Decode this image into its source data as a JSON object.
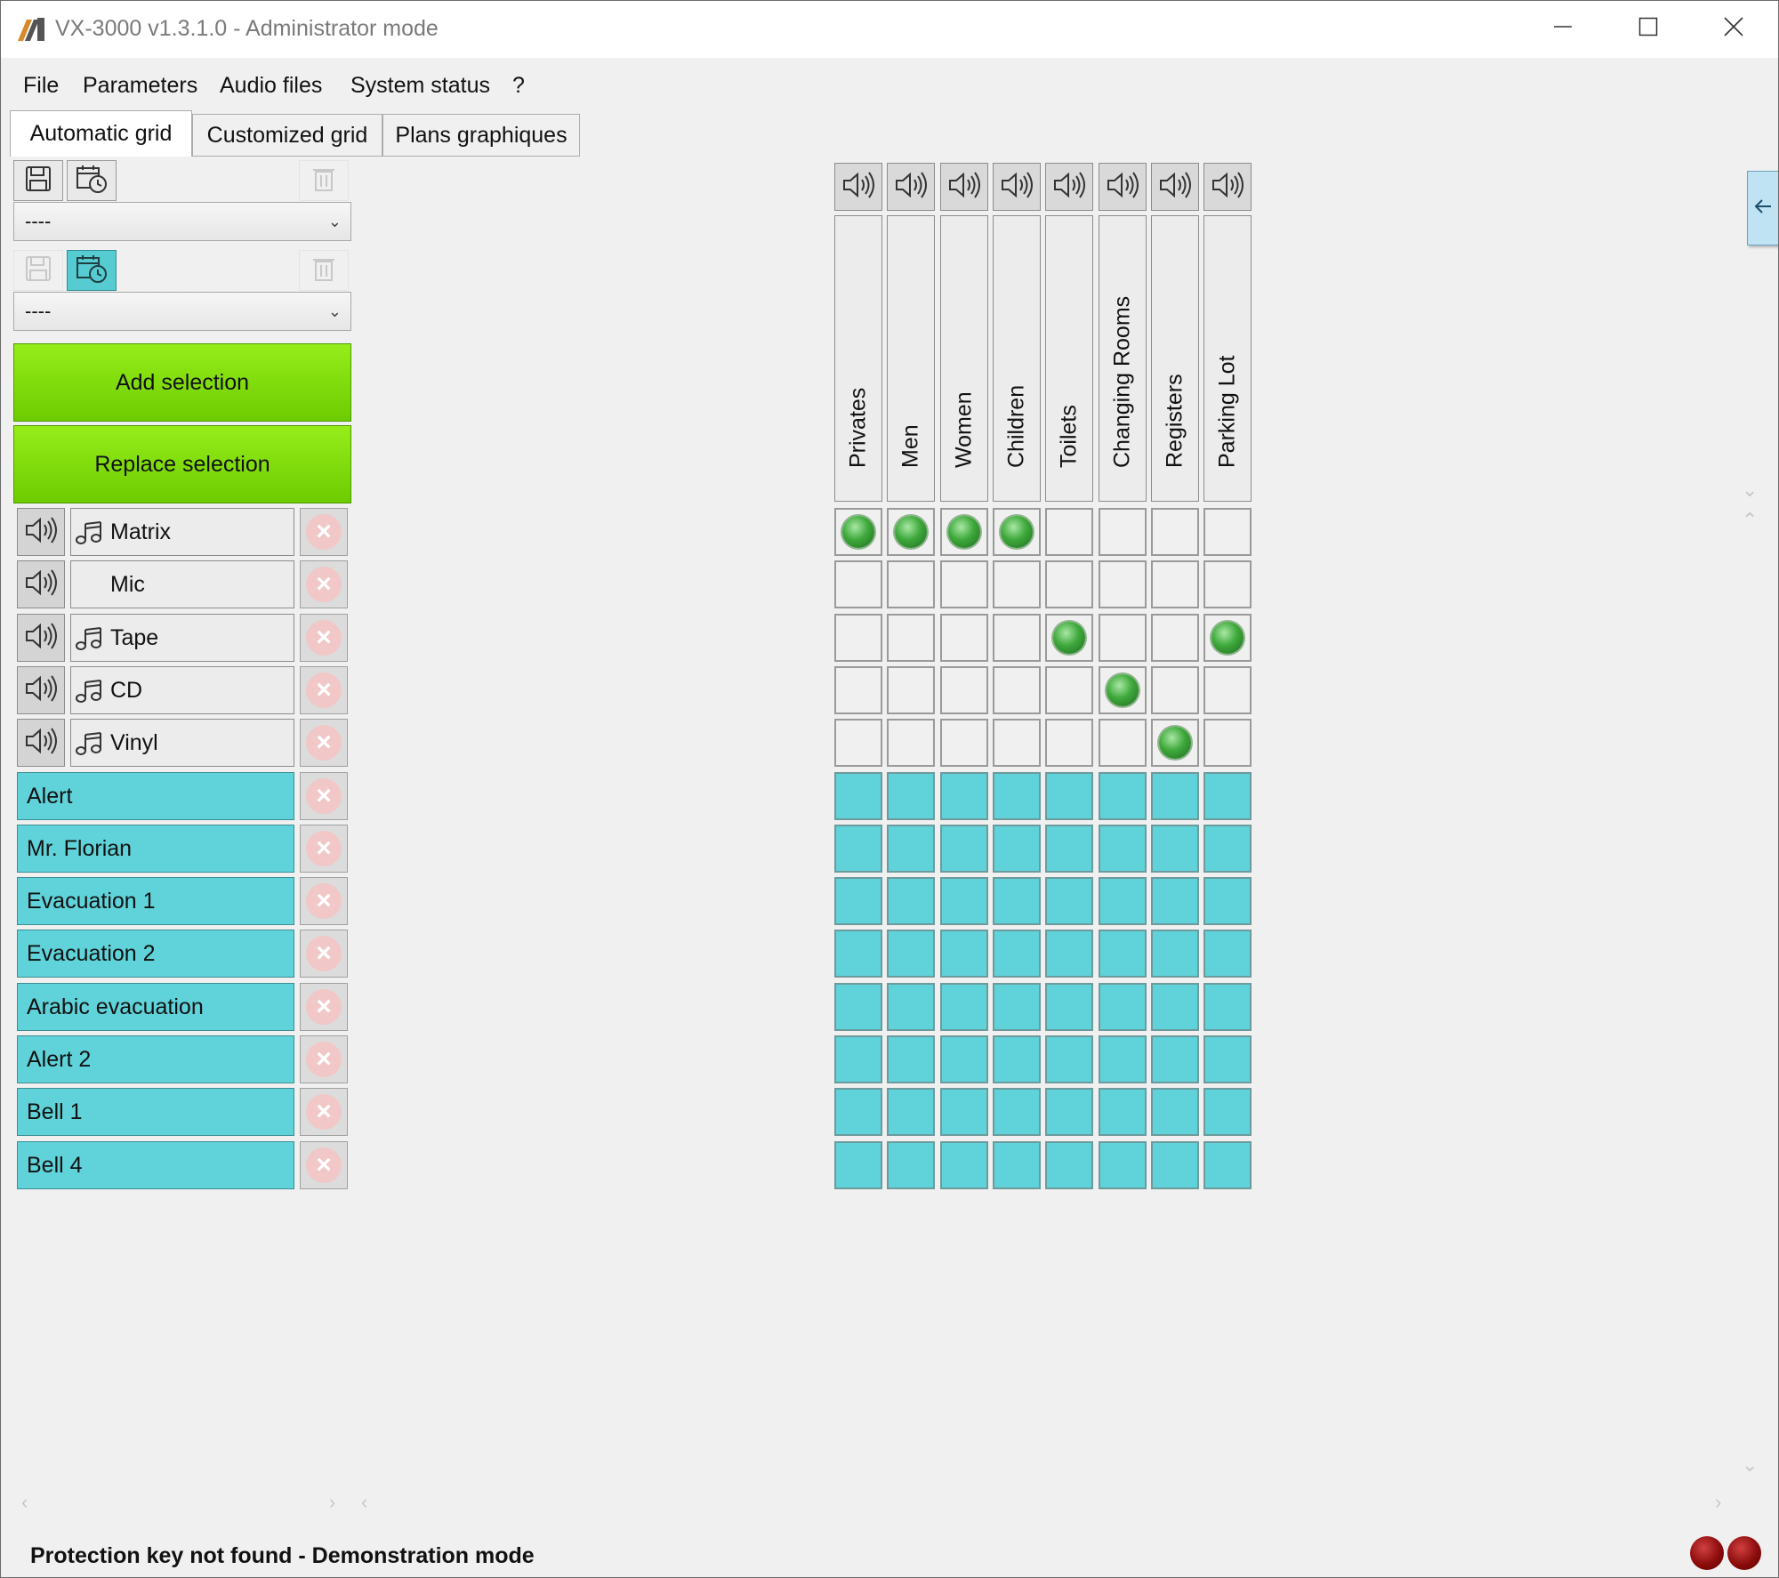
{
  "window": {
    "title": "VX-3000 v1.3.1.0 - Administrator mode",
    "controls": [
      "minimize-icon",
      "maximize-icon",
      "close-icon"
    ]
  },
  "menu": [
    "File",
    "Parameters",
    "Audio files",
    "System status",
    "?"
  ],
  "tabs": [
    "Automatic grid",
    "Customized grid",
    "Plans graphiques"
  ],
  "active_tab": "Automatic grid",
  "presets": {
    "combo1_value": "----",
    "combo2_value": "----"
  },
  "buttons": {
    "add_selection": "Add selection",
    "replace_selection": "Replace selection"
  },
  "sources": [
    {
      "label": "Matrix",
      "type": "audio",
      "music_icon": true
    },
    {
      "label": "Mic",
      "type": "audio",
      "music_icon": false
    },
    {
      "label": "Tape",
      "type": "audio",
      "music_icon": true
    },
    {
      "label": "CD",
      "type": "audio",
      "music_icon": true
    },
    {
      "label": "Vinyl",
      "type": "audio",
      "music_icon": true
    },
    {
      "label": "Alert",
      "type": "message"
    },
    {
      "label": "Mr. Florian",
      "type": "message"
    },
    {
      "label": "Evacuation 1",
      "type": "message"
    },
    {
      "label": "Evacuation 2",
      "type": "message"
    },
    {
      "label": "Arabic evacuation",
      "type": "message"
    },
    {
      "label": "Alert 2",
      "type": "message"
    },
    {
      "label": "Bell 1",
      "type": "message"
    },
    {
      "label": "Bell 4",
      "type": "message"
    }
  ],
  "zones": [
    "Privates",
    "Men",
    "Women",
    "Children",
    "Toilets",
    "Changing Rooms",
    "Registers",
    "Parking Lot"
  ],
  "routing_on": {
    "Matrix": [
      "Privates",
      "Men",
      "Women",
      "Children"
    ],
    "Mic": [],
    "Tape": [
      "Toilets",
      "Parking Lot"
    ],
    "CD": [
      "Changing Rooms"
    ],
    "Vinyl": [
      "Registers"
    ]
  },
  "status": {
    "message": "Protection key not found - Demonstration mode",
    "indicators": [
      "red",
      "red"
    ]
  },
  "colors": {
    "accent_cyan": "#5fd3d9",
    "button_green": "#7ed600",
    "led_green": "#3fa93c",
    "led_red": "#8c0c0c"
  }
}
